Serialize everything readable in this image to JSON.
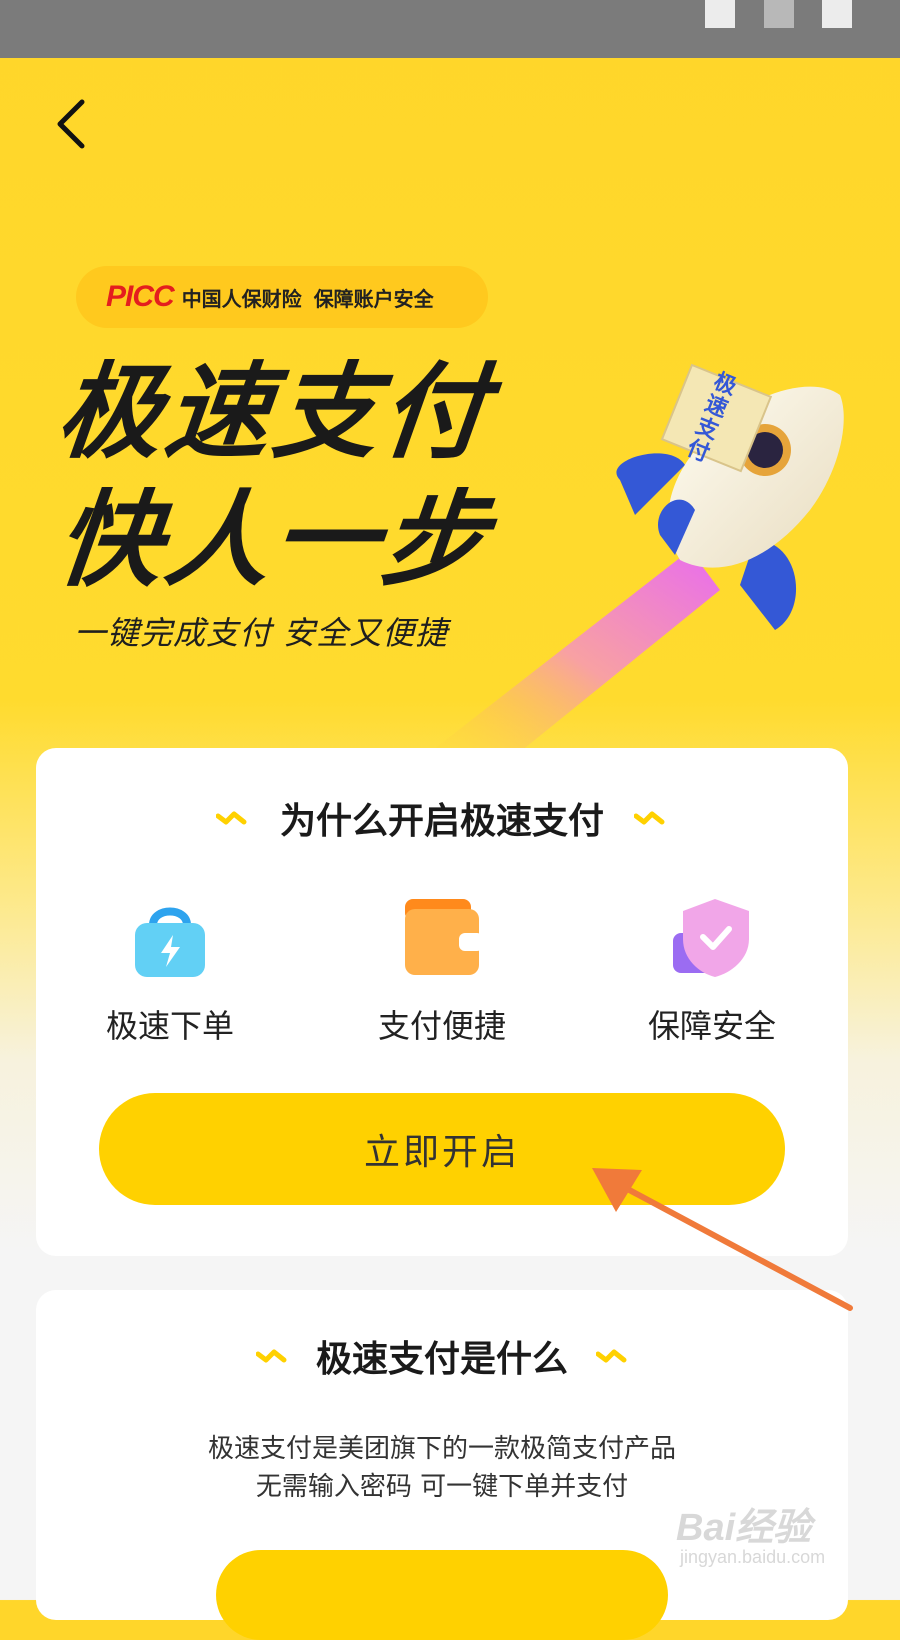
{
  "status_bar": {},
  "nav": {
    "back_icon": "chevron-left-icon"
  },
  "badge": {
    "brand": "PICC",
    "company": "中国人保财险",
    "tagline": "保障账户安全"
  },
  "hero": {
    "line1": "极速支付",
    "line2": "快人一步",
    "subtitle": "一键完成支付 安全又便捷"
  },
  "rocket_flag": "极速支付",
  "why_card": {
    "title": "为什么开启极速支付",
    "features": [
      {
        "label": "极速下单",
        "icon": "shopping-bag-bolt-icon"
      },
      {
        "label": "支付便捷",
        "icon": "wallet-icon"
      },
      {
        "label": "保障安全",
        "icon": "shield-check-icon"
      }
    ],
    "cta_label": "立即开启"
  },
  "what_card": {
    "title": "极速支付是什么",
    "desc_line1": "极速支付是美团旗下的一款极简支付产品",
    "desc_line2": "无需输入密码  可一键下单并支付"
  },
  "watermark": {
    "brand": "Bai经验",
    "url": "jingyan.baidu.com"
  },
  "colors": {
    "accent_yellow": "#ffd100",
    "annotation_arrow": "#f07a3a",
    "picc_red": "#e41e1e"
  }
}
